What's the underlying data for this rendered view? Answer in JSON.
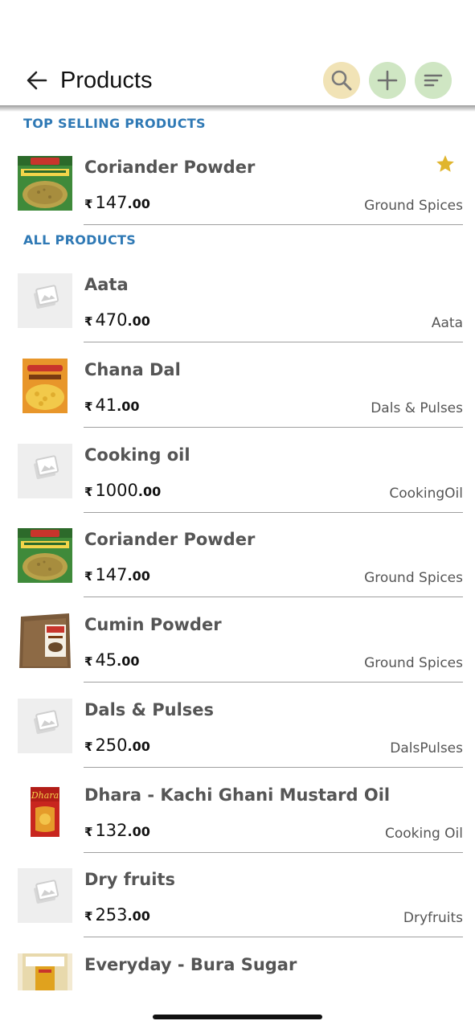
{
  "header": {
    "title": "Products",
    "back_icon": "arrow-left-icon",
    "actions": [
      {
        "name": "search-button",
        "icon": "search-icon",
        "color": "#f1e3b6"
      },
      {
        "name": "add-button",
        "icon": "plus-icon",
        "color": "#cfe6c3"
      },
      {
        "name": "sort-button",
        "icon": "sort-lines-icon",
        "color": "#cfe6c3"
      }
    ]
  },
  "colors": {
    "section_title": "#2f79b5",
    "star": "#e0b52e",
    "divider": "#9f9f9f"
  },
  "top_selling": {
    "title": "TOP SELLING PRODUCTS",
    "items": [
      {
        "name": "Coriander Powder",
        "currency": "₹",
        "price_int": "147",
        "price_dec": ".00",
        "category": "Ground Spices",
        "image": "coriander-pack",
        "starred": true
      }
    ]
  },
  "all_products": {
    "title": "ALL PRODUCTS",
    "items": [
      {
        "name": "Aata",
        "currency": "₹",
        "price_int": "470",
        "price_dec": ".00",
        "category": "Aata",
        "image": "placeholder"
      },
      {
        "name": "Chana Dal",
        "currency": "₹",
        "price_int": "41",
        "price_dec": ".00",
        "category": "Dals & Pulses",
        "image": "chana-dal-pack"
      },
      {
        "name": "Cooking oil",
        "currency": "₹",
        "price_int": "1000",
        "price_dec": ".00",
        "category": "CookingOil",
        "image": "placeholder"
      },
      {
        "name": "Coriander Powder",
        "currency": "₹",
        "price_int": "147",
        "price_dec": ".00",
        "category": "Ground Spices",
        "image": "coriander-pack"
      },
      {
        "name": "Cumin Powder",
        "currency": "₹",
        "price_int": "45",
        "price_dec": ".00",
        "category": "Ground Spices",
        "image": "cumin-pack"
      },
      {
        "name": "Dals & Pulses",
        "currency": "₹",
        "price_int": "250",
        "price_dec": ".00",
        "category": "DalsPulses",
        "image": "placeholder"
      },
      {
        "name": "Dhara - Kachi Ghani Mustard Oil",
        "currency": "₹",
        "price_int": "132",
        "price_dec": ".00",
        "category": "Cooking Oil",
        "image": "dhara-oil-pack"
      },
      {
        "name": "Dry fruits",
        "currency": "₹",
        "price_int": "253",
        "price_dec": ".00",
        "category": "Dryfruits",
        "image": "placeholder"
      },
      {
        "name": "Everyday - Bura Sugar",
        "currency": "",
        "price_int": "",
        "price_dec": "",
        "category": "",
        "image": "sugar-pack"
      }
    ]
  }
}
